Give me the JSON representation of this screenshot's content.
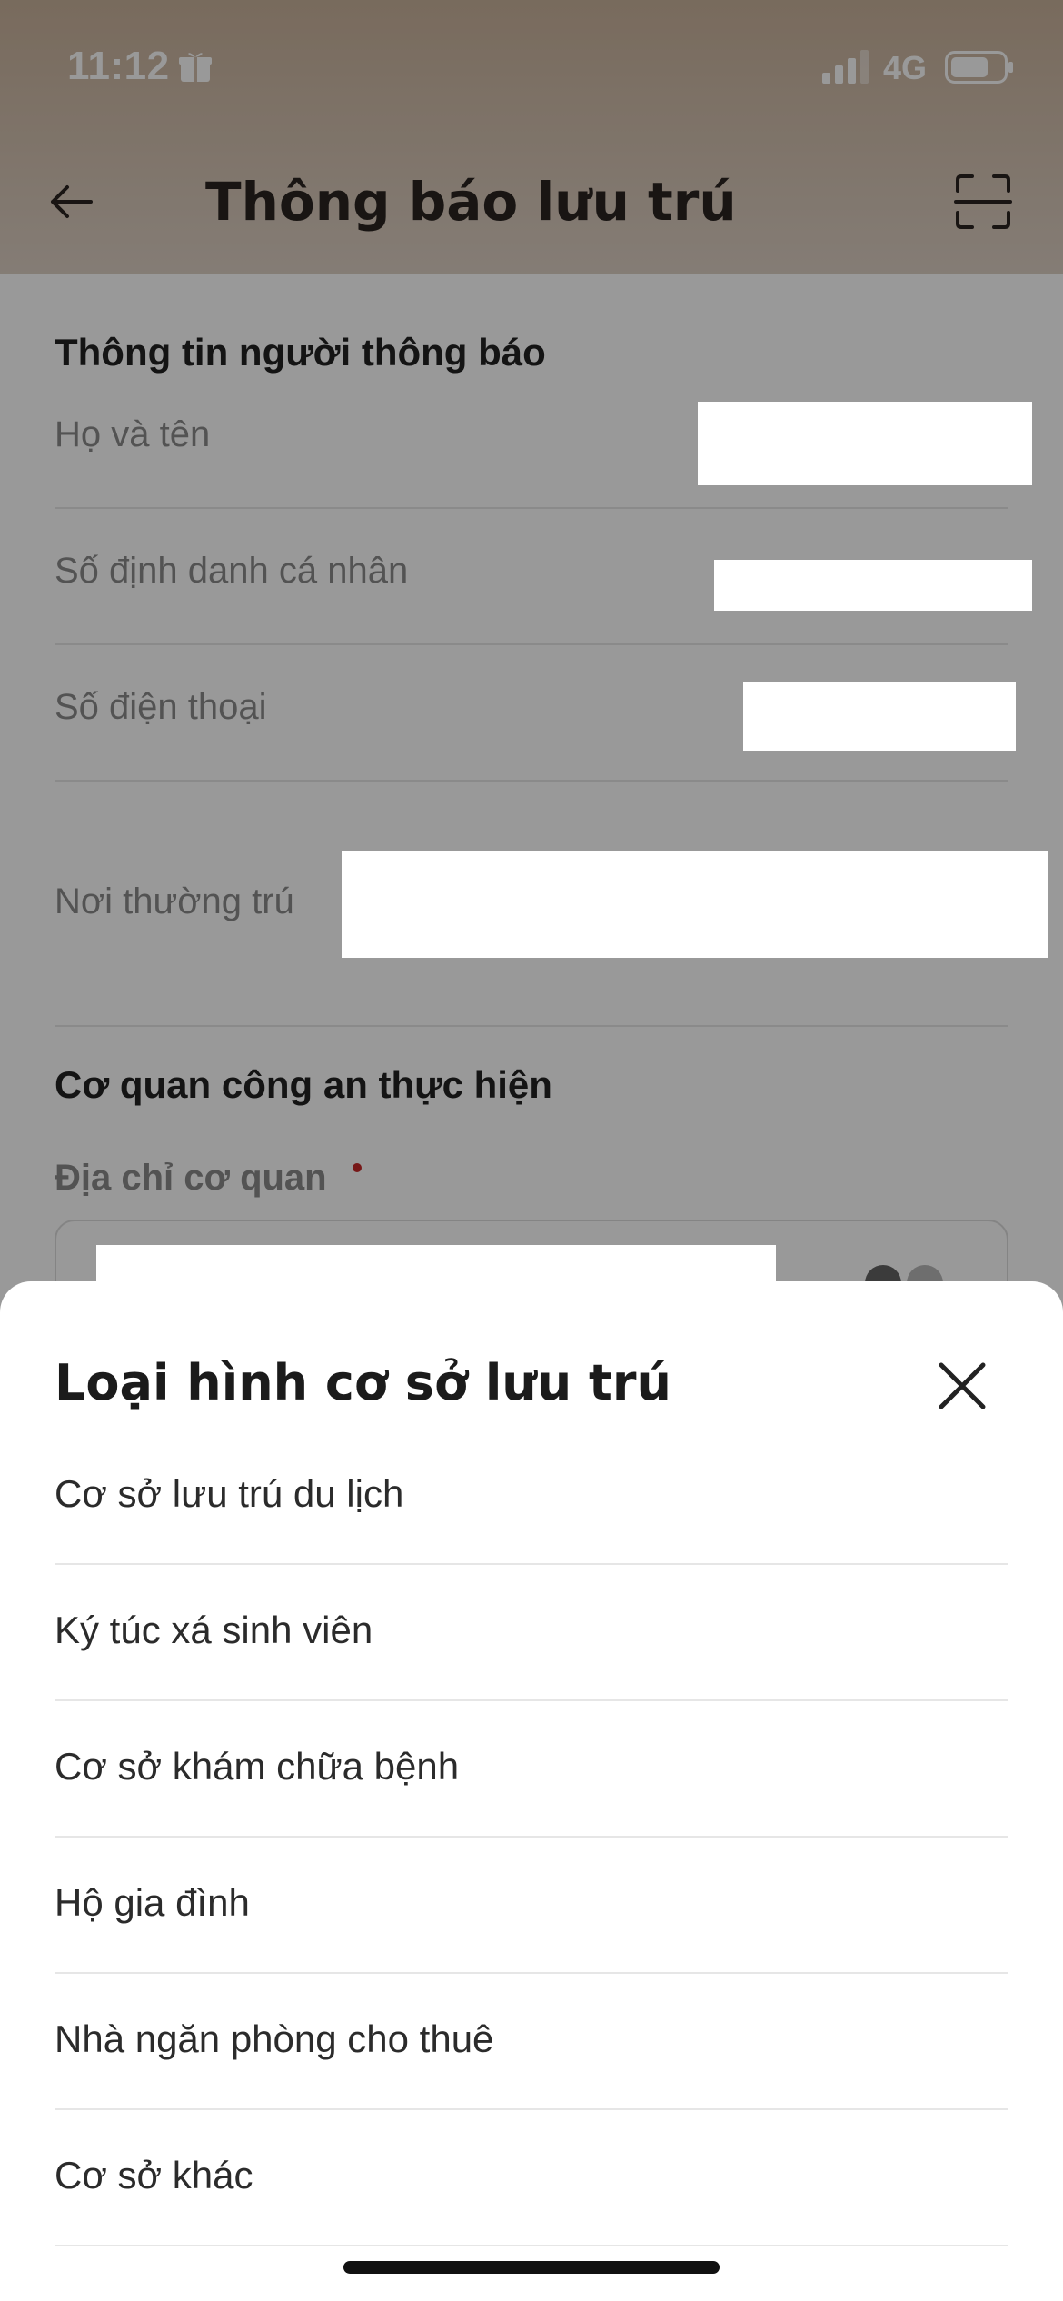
{
  "status_bar": {
    "time": "11:12",
    "network": "4G",
    "icons": [
      "gift-icon",
      "signal-icon",
      "battery-icon"
    ]
  },
  "header": {
    "title": "Thông báo lưu trú",
    "icons": [
      "back-arrow-icon",
      "scan-icon"
    ]
  },
  "notifier_section": {
    "title": "Thông tin người thông báo",
    "rows": [
      {
        "label": "Họ và tên"
      },
      {
        "label": "Số định danh cá nhân"
      },
      {
        "label": "Số điện thoại"
      },
      {
        "label": "Nơi thường trú"
      }
    ]
  },
  "agency_section": {
    "title": "Cơ quan công an thực hiện",
    "address_label": "Địa chỉ cơ quan"
  },
  "sheet": {
    "title": "Loại hình cơ sở lưu trú",
    "options": [
      {
        "label": "Cơ sở lưu trú du lịch"
      },
      {
        "label": "Ký túc xá sinh viên"
      },
      {
        "label": "Cơ sở khám chữa bệnh"
      },
      {
        "label": "Hộ gia đình"
      },
      {
        "label": "Nhà ngăn phòng cho thuê"
      },
      {
        "label": "Cơ sở khác"
      }
    ]
  },
  "colors": {
    "header_bg": "#c9b29b",
    "required_dot": "#c62828",
    "divider": "#e6e6e6"
  }
}
